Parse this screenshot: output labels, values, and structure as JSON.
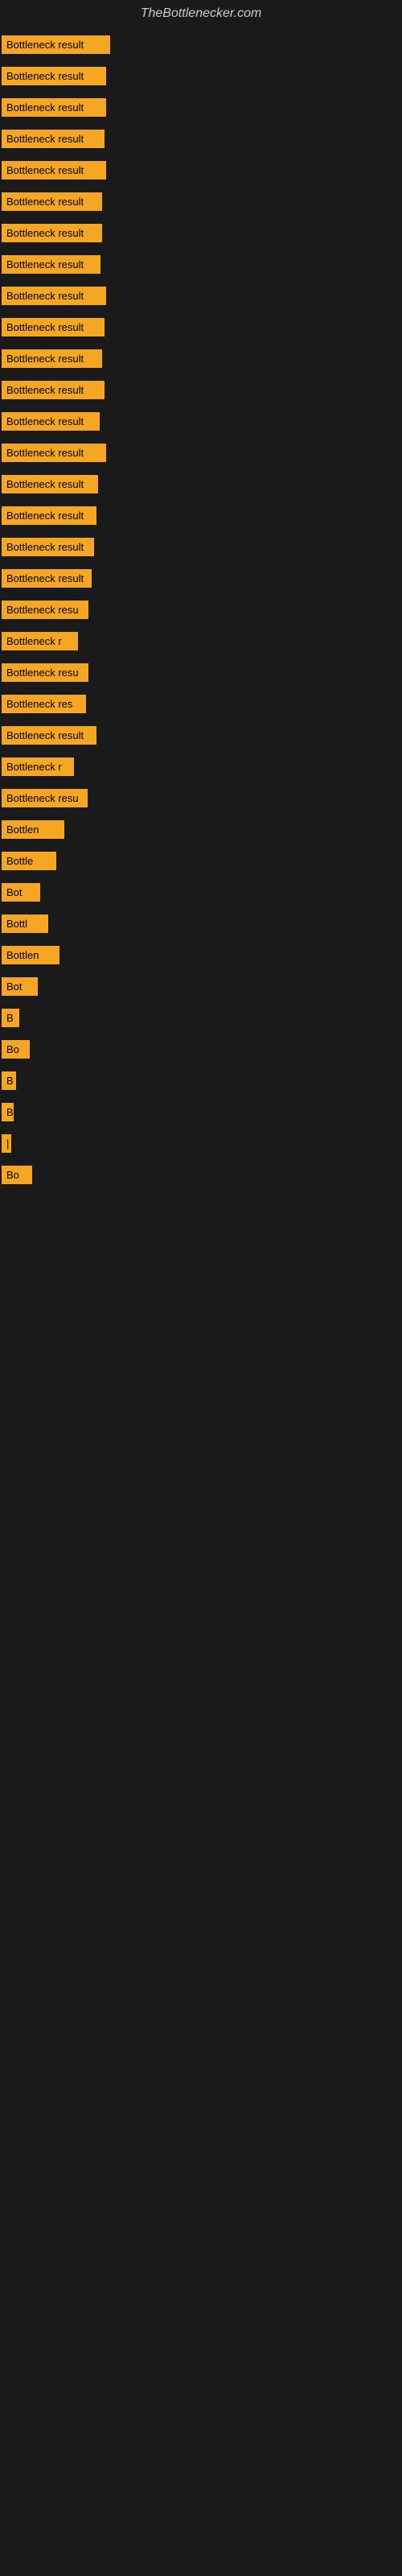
{
  "site_title": "TheBottlenecker.com",
  "bars": [
    {
      "label": "Bottleneck result",
      "width": 135
    },
    {
      "label": "Bottleneck result",
      "width": 130
    },
    {
      "label": "Bottleneck result",
      "width": 130
    },
    {
      "label": "Bottleneck result",
      "width": 128
    },
    {
      "label": "Bottleneck result",
      "width": 130
    },
    {
      "label": "Bottleneck result",
      "width": 125
    },
    {
      "label": "Bottleneck result",
      "width": 125
    },
    {
      "label": "Bottleneck result",
      "width": 123
    },
    {
      "label": "Bottleneck result",
      "width": 130
    },
    {
      "label": "Bottleneck result",
      "width": 128
    },
    {
      "label": "Bottleneck result",
      "width": 125
    },
    {
      "label": "Bottleneck result",
      "width": 128
    },
    {
      "label": "Bottleneck result",
      "width": 122
    },
    {
      "label": "Bottleneck result",
      "width": 130
    },
    {
      "label": "Bottleneck result",
      "width": 120
    },
    {
      "label": "Bottleneck result",
      "width": 118
    },
    {
      "label": "Bottleneck result",
      "width": 115
    },
    {
      "label": "Bottleneck result",
      "width": 112
    },
    {
      "label": "Bottleneck resu",
      "width": 108
    },
    {
      "label": "Bottleneck r",
      "width": 95
    },
    {
      "label": "Bottleneck resu",
      "width": 108
    },
    {
      "label": "Bottleneck res",
      "width": 105
    },
    {
      "label": "Bottleneck result",
      "width": 118
    },
    {
      "label": "Bottleneck r",
      "width": 90
    },
    {
      "label": "Bottleneck resu",
      "width": 107
    },
    {
      "label": "Bottlen",
      "width": 78
    },
    {
      "label": "Bottle",
      "width": 68
    },
    {
      "label": "Bot",
      "width": 48
    },
    {
      "label": "Bottl",
      "width": 58
    },
    {
      "label": "Bottlen",
      "width": 72
    },
    {
      "label": "Bot",
      "width": 45
    },
    {
      "label": "B",
      "width": 22
    },
    {
      "label": "Bo",
      "width": 35
    },
    {
      "label": "B",
      "width": 18
    },
    {
      "label": "B",
      "width": 15
    },
    {
      "label": "|",
      "width": 10
    },
    {
      "label": "Bo",
      "width": 38
    }
  ]
}
